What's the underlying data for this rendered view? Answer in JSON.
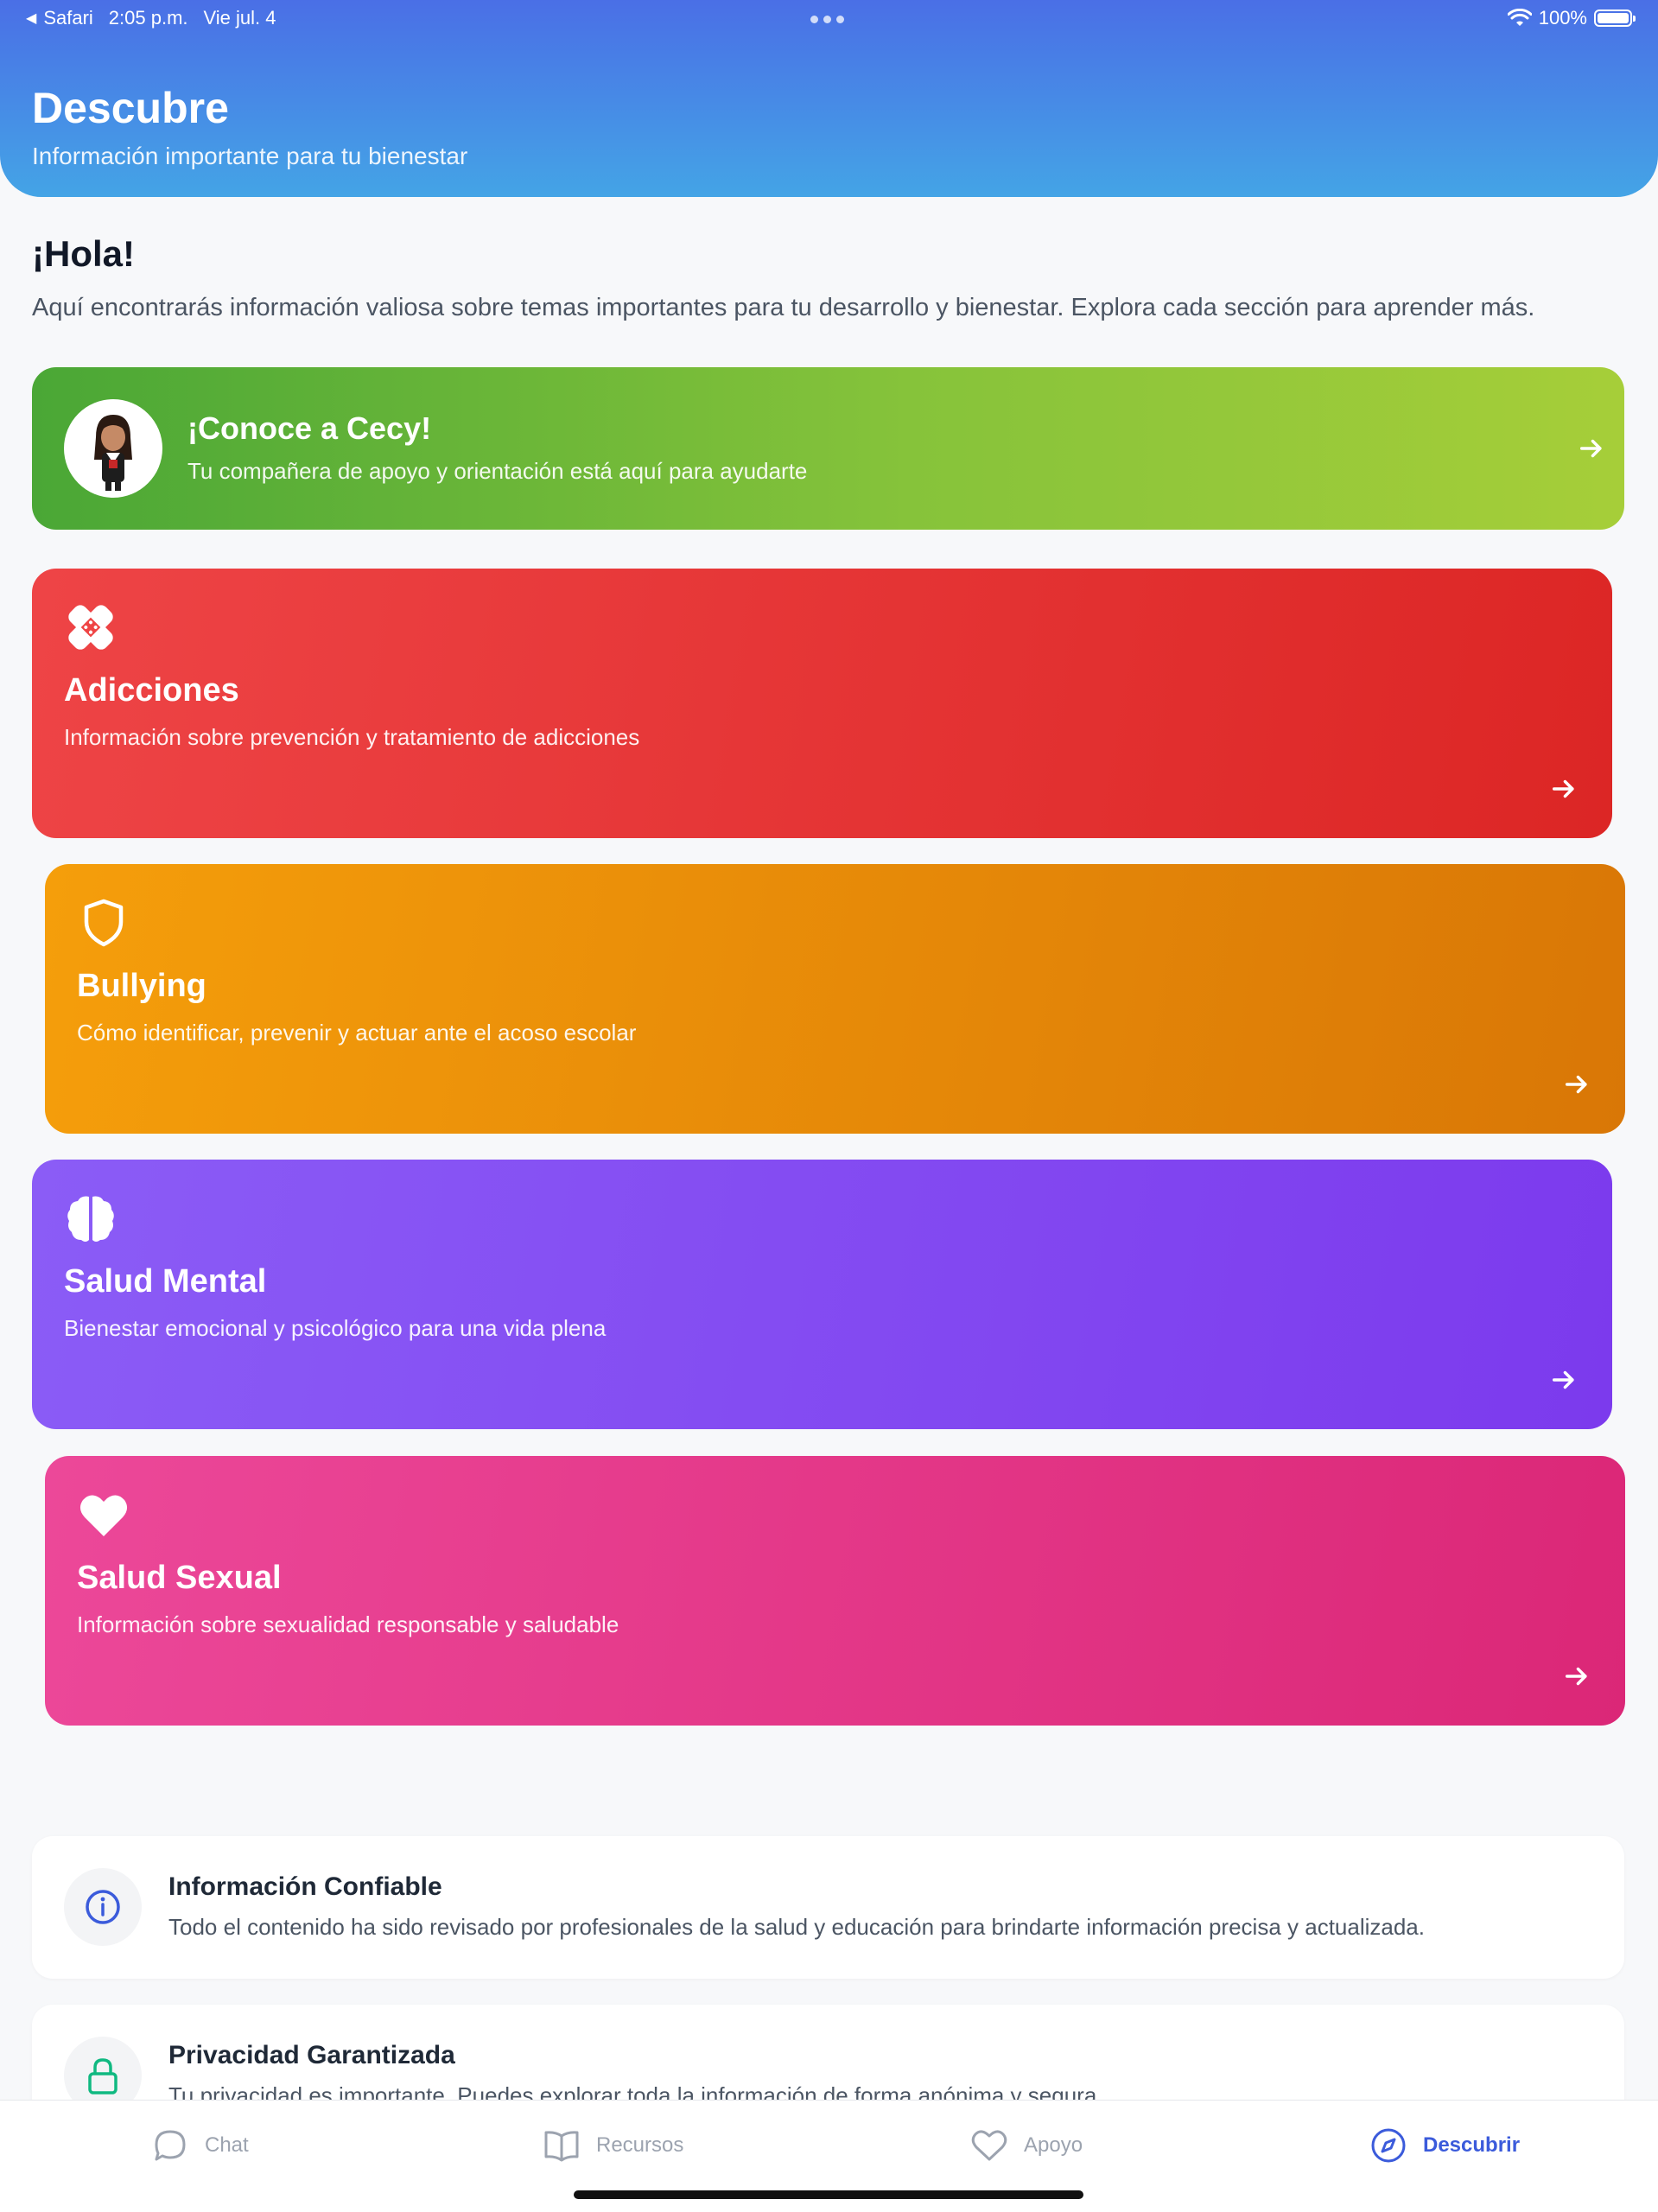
{
  "status_bar": {
    "app": "Safari",
    "time": "2:05 p.m.",
    "date": "Vie jul. 4",
    "battery": "100%"
  },
  "header": {
    "title": "Descubre",
    "subtitle": "Información importante para tu bienestar"
  },
  "greeting": {
    "title": "¡Hola!",
    "text": "Aquí encontrarás información valiosa sobre temas importantes para tu desarrollo y bienestar. Explora cada sección para aprender más."
  },
  "cecy": {
    "title": "¡Conoce a Cecy!",
    "subtitle": "Tu compañera de apoyo y orientación está aquí para ayudarte",
    "icon": "cecy-avatar"
  },
  "topics": [
    {
      "title": "Adicciones",
      "subtitle": "Información sobre prevención y tratamiento de adicciones",
      "icon": "bandage-icon",
      "color": "#ef4444"
    },
    {
      "title": "Bullying",
      "subtitle": "Cómo identificar, prevenir y actuar ante el acoso escolar",
      "icon": "shield-icon",
      "color": "#f59e0b"
    },
    {
      "title": "Salud Mental",
      "subtitle": "Bienestar emocional y psicológico para una vida plena",
      "icon": "brain-icon",
      "color": "#8b5cf6"
    },
    {
      "title": "Salud Sexual",
      "subtitle": "Información sobre sexualidad responsable y saludable",
      "icon": "heart-icon",
      "color": "#ec4899"
    }
  ],
  "info": [
    {
      "title": "Información Confiable",
      "text": "Todo el contenido ha sido revisado por profesionales de la salud y educación para brindarte información precisa y actualizada.",
      "icon": "info-icon"
    },
    {
      "title": "Privacidad Garantizada",
      "text": "Tu privacidad es importante. Puedes explorar toda la información de forma anónima y segura.",
      "icon": "lock-icon"
    }
  ],
  "tabs": [
    {
      "label": "Chat",
      "icon": "chat-icon",
      "active": false
    },
    {
      "label": "Recursos",
      "icon": "book-icon",
      "active": false
    },
    {
      "label": "Apoyo",
      "icon": "heart-outline-icon",
      "active": false
    },
    {
      "label": "Descubrir",
      "icon": "compass-icon",
      "active": true
    }
  ],
  "colors": {
    "header_start": "#4a6fe6",
    "header_end": "#44a4e6",
    "active_tab": "#3b5bdb"
  }
}
